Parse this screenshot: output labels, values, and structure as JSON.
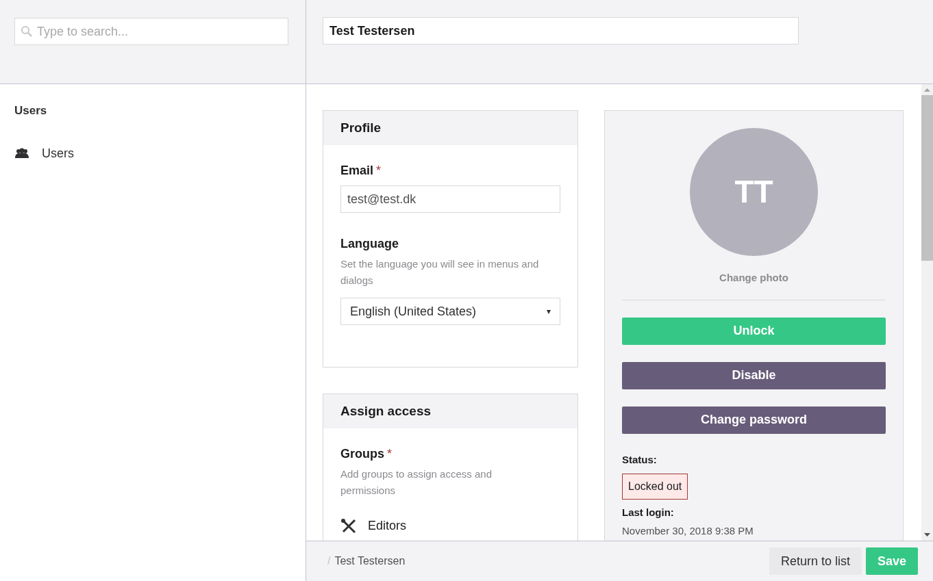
{
  "search": {
    "placeholder": "Type to search..."
  },
  "name_field": {
    "value": "Test Testersen"
  },
  "sidebar": {
    "title": "Users",
    "items": [
      {
        "label": "Users"
      }
    ]
  },
  "profile": {
    "title": "Profile",
    "email": {
      "label": "Email",
      "required_mark": "*",
      "value": "test@test.dk"
    },
    "language": {
      "label": "Language",
      "description": "Set the language you will see in menus and dialogs",
      "value": "English (United States)",
      "caret": "▾"
    }
  },
  "assign_access": {
    "title": "Assign access",
    "groups": {
      "label": "Groups",
      "required_mark": "*",
      "description": "Add groups to assign access and permissions",
      "items": [
        {
          "name": "Editors"
        }
      ]
    }
  },
  "user_panel": {
    "initials": "TT",
    "change_photo": "Change photo",
    "buttons": [
      {
        "label": "Unlock",
        "kind": "primary"
      },
      {
        "label": "Disable",
        "kind": "secondary"
      },
      {
        "label": "Change password",
        "kind": "secondary"
      }
    ],
    "status_label": "Status:",
    "status": "Locked out",
    "last_login_label": "Last login:",
    "last_login": "November 30, 2018 9:38 PM"
  },
  "footer": {
    "separator": "/",
    "breadcrumb": "Test Testersen",
    "buttons": [
      {
        "label": "Return to list",
        "kind": "secondary"
      },
      {
        "label": "Save",
        "kind": "primary"
      }
    ]
  }
}
